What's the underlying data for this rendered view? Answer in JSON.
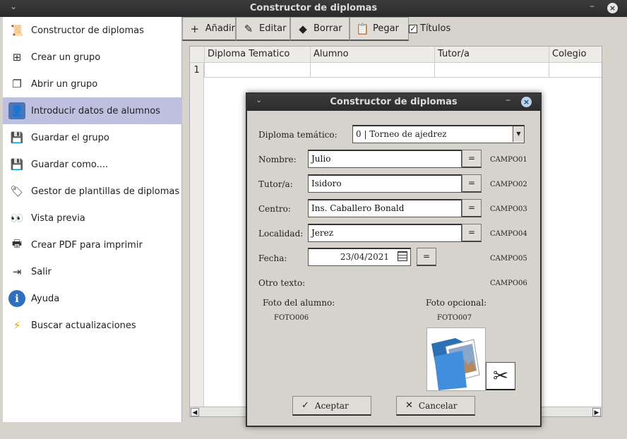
{
  "window": {
    "title": "Constructor de diplomas"
  },
  "sidebar": {
    "items": [
      {
        "label": "Constructor de diplomas",
        "icon": "diploma-icon",
        "glyph": "📜"
      },
      {
        "label": "Crear un grupo",
        "icon": "plus-square-icon",
        "glyph": "⊞"
      },
      {
        "label": "Abrir un grupo",
        "icon": "copy-icon",
        "glyph": "❐"
      },
      {
        "label": "Introducir datos de alumnos",
        "icon": "user-icon",
        "glyph": "👤"
      },
      {
        "label": "Guardar el grupo",
        "icon": "save-icon",
        "glyph": "💾"
      },
      {
        "label": "Guardar como....",
        "icon": "save-as-icon",
        "glyph": "💾"
      },
      {
        "label": "Gestor de plantillas de diplomas",
        "icon": "templates-icon",
        "glyph": "🏷"
      },
      {
        "label": "Vista previa",
        "icon": "eyes-icon",
        "glyph": "👀"
      },
      {
        "label": "Crear PDF para imprimir",
        "icon": "printer-icon",
        "glyph": "🖶"
      },
      {
        "label": "Salir",
        "icon": "exit-icon",
        "glyph": "⇥"
      },
      {
        "label": "Ayuda",
        "icon": "info-icon",
        "glyph": "ℹ"
      },
      {
        "label": "Buscar actualizaciones",
        "icon": "lightning-icon",
        "glyph": "⚡"
      }
    ],
    "active_index": 3
  },
  "toolbar": {
    "add_label": "Añadir",
    "edit_label": "Editar",
    "delete_label": "Borrar",
    "paste_label": "Pegar",
    "titles_label": "Títulos",
    "titles_checked": true
  },
  "grid": {
    "columns": [
      "Diploma Tematico",
      "Alumno",
      "Tutor/a",
      "Colegio"
    ],
    "rows": [
      "1"
    ]
  },
  "dialog": {
    "title": "Constructor de diplomas",
    "diploma_label": "Diploma temático:",
    "diploma_value": "0  |  Torneo de ajedrez",
    "fields": [
      {
        "label": "Nombre:",
        "value": "Julio",
        "code": "CAMPO01"
      },
      {
        "label": "Tutor/a:",
        "value": "Isidoro",
        "code": "CAMPO02"
      },
      {
        "label": "Centro:",
        "value": "Ins. Caballero Bonald",
        "code": "CAMPO03"
      },
      {
        "label": "Localidad:",
        "value": "Jerez",
        "code": "CAMPO04"
      }
    ],
    "fecha": {
      "label": "Fecha:",
      "value": "23/04/2021",
      "code": "CAMPO05"
    },
    "otro_texto": {
      "label": "Otro texto:",
      "code": "CAMPO06"
    },
    "eq_label": "=",
    "foto_alumno": {
      "label": "Foto del alumno:",
      "code": "FOTO006"
    },
    "foto_opcional": {
      "label": "Foto opcional:",
      "code": "FOTO007"
    },
    "accept_label": "Aceptar",
    "cancel_label": "Cancelar"
  }
}
